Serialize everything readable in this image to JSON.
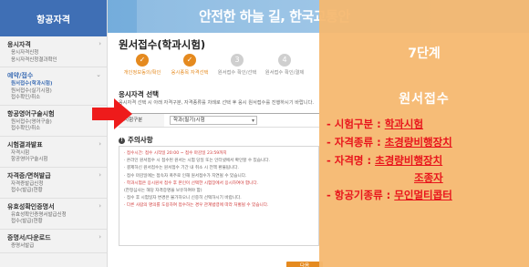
{
  "banner": {
    "text": "안전한 하늘 길, 한국교통안"
  },
  "sidebar": {
    "title": "항공자격",
    "sections": [
      {
        "label": "응시자격",
        "subs": [
          "응시자격신청",
          "응시자격신청결과확인"
        ],
        "active": false
      },
      {
        "label": "예약/접수",
        "subs": [
          "원서접수(학과시험)",
          "원서접수(실기시험)",
          "접수확인/취소"
        ],
        "active": true
      },
      {
        "label": "항공영어구술시험",
        "subs": [
          "원서접수(영어구술)",
          "접수확인/취소"
        ],
        "active": false
      },
      {
        "label": "시험결과발표",
        "subs": [
          "자격시험",
          "항공영어구술시험"
        ],
        "active": false
      },
      {
        "label": "자격증/면허발급",
        "subs": [
          "자격증발급신청",
          "접수(발급)현황"
        ],
        "active": false
      },
      {
        "label": "유효성확인증명서",
        "subs": [
          "유효성확인증명서발급신청",
          "접수(발급)현황"
        ],
        "active": false
      },
      {
        "label": "증명서/다운로드",
        "subs": [
          "증명서발급"
        ],
        "active": false
      }
    ]
  },
  "main": {
    "title": "원서접수(학과시험)",
    "steps": [
      {
        "label": "개인정보동의/확인",
        "num": "1",
        "done": true
      },
      {
        "label": "응시종목 자격선택",
        "num": "2",
        "done": true
      },
      {
        "label": "원서접수 확인/선택",
        "num": "3",
        "done": false
      },
      {
        "label": "원서접수 확인/결제",
        "num": "4",
        "done": false
      }
    ],
    "section_label": "응시자격 선택",
    "section_desc": "응시자격 선택 시 아래 자격구분, 자격종류를 차례로 선택 후 응시 원서접수를 진행하시기 바랍니다.",
    "field_label": "시험구분",
    "field_value": "학과(필기)시험",
    "notice_title": "주의사항",
    "notices": [
      {
        "text": "· 접수시간: 접수 시작일 20:00 ~ 접수 마감일 23:59까지",
        "red": true
      },
      {
        "text": "· 온라인 원서접수 시 접수된 원서는 시험 당일 또는 인터넷에서 확인할 수 있습니다.",
        "red": false
      },
      {
        "text": "· 결제하신 원서접수는 원서접수 기간 내 취소 시 전액 환불됩니다.",
        "red": false
      },
      {
        "text": "· 접수 마감일에는 접속자 폭주로 인해 원서접수가 지연될 수 있습니다.",
        "red": false
      },
      {
        "text": "· 학과시험은 응시원서 접수 후 본인이 선택한 시험장에서 응시하여야 합니다.",
        "red": true
      },
      {
        "text": "  (한정심사는 해당 자격증명을 보유하여야 함)",
        "red": false
      },
      {
        "text": "· 접수 후 시험일자 변경은 불가하오니 신중히 선택하시기 바랍니다.",
        "red": false
      },
      {
        "text": "· 다른 사람의 명의를 도용하여 접수하는 경우 관계법령에 따라 처벌될 수 있습니다.",
        "red": true
      }
    ],
    "next_button": "다음"
  },
  "overlay": {
    "step": "7단계",
    "title": "원서접수",
    "items": [
      {
        "key": "- 시험구분 : ",
        "value": "학과시험"
      },
      {
        "key": "- 자격종류 : ",
        "value": "초경량비행장치"
      },
      {
        "key": "- 자격명 : ",
        "value": "초경량비행장치"
      },
      {
        "key": "",
        "value": "조종자",
        "cont": true
      },
      {
        "key": "- 항공기종류 : ",
        "value": "무인멀티콥터"
      }
    ]
  },
  "colors": {
    "accent": "#e58a1f",
    "overlay": "#f6b870",
    "highlight": "#e8151c",
    "sidebar_header": "#3f6fb5"
  }
}
